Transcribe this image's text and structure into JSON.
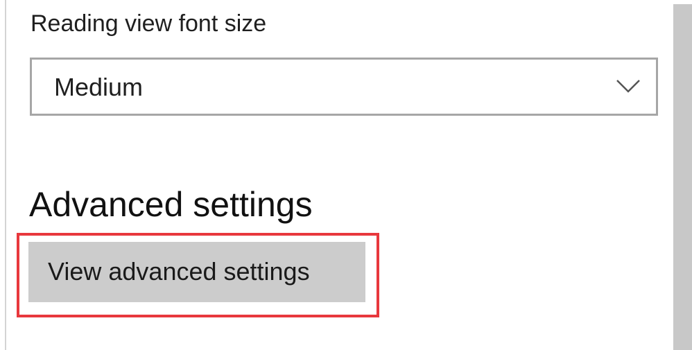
{
  "reading_view": {
    "font_size_label": "Reading view font size",
    "font_size_dropdown": {
      "selected": "Medium",
      "icon": "chevron-down-icon"
    }
  },
  "advanced": {
    "heading": "Advanced settings",
    "view_button_label": "View advanced settings",
    "highlight_color": "#e8383d"
  },
  "colors": {
    "button_background": "#cccccc",
    "scrollbar": "#c8c8c8",
    "dropdown_border": "#a6a6a6"
  }
}
